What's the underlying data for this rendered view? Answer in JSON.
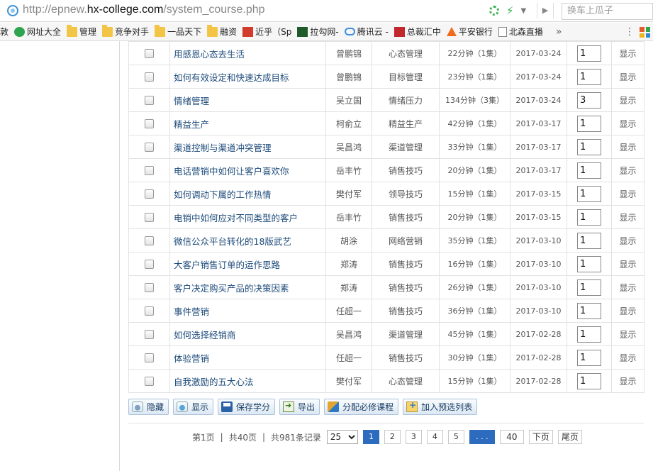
{
  "browser": {
    "url_prefix": "http://epnew.",
    "url_host": "hx-college.com",
    "url_path": "/system_course.php",
    "search_placeholder": "换车上瓜子"
  },
  "bookmarks": [
    {
      "label": "敦",
      "icon": "none"
    },
    {
      "label": "网址大全",
      "icon": "green"
    },
    {
      "label": "管理",
      "icon": "folder"
    },
    {
      "label": "竞争对手",
      "icon": "folder"
    },
    {
      "label": "一品天下",
      "icon": "folder"
    },
    {
      "label": "融资",
      "icon": "folder"
    },
    {
      "label": "近乎（Sp",
      "icon": "red"
    },
    {
      "label": "拉勾网-",
      "icon": "dark"
    },
    {
      "label": "腾讯云 -",
      "icon": "cloud"
    },
    {
      "label": "总裁汇中",
      "icon": "crown"
    },
    {
      "label": "平安银行",
      "icon": "tri"
    },
    {
      "label": "北森直播",
      "icon": "page"
    }
  ],
  "courses": [
    {
      "name": "用感恩心态去生活",
      "teacher": "曾鹏锦",
      "category": "心态管理",
      "duration": "22分钟（1集）",
      "date": "2017-03-24",
      "credit": "1",
      "action": "显示"
    },
    {
      "name": "如何有效设定和快速达成目标",
      "teacher": "曾鹏锦",
      "category": "目标管理",
      "duration": "23分钟（1集）",
      "date": "2017-03-24",
      "credit": "1",
      "action": "显示"
    },
    {
      "name": "情绪管理",
      "teacher": "吴立国",
      "category": "情绪压力",
      "duration": "134分钟（3集）",
      "date": "2017-03-24",
      "credit": "3",
      "action": "显示"
    },
    {
      "name": "精益生产",
      "teacher": "柯俞立",
      "category": "精益生产",
      "duration": "42分钟（1集）",
      "date": "2017-03-17",
      "credit": "1",
      "action": "显示"
    },
    {
      "name": "渠道控制与渠道冲突管理",
      "teacher": "吴昌鸿",
      "category": "渠道管理",
      "duration": "33分钟（1集）",
      "date": "2017-03-17",
      "credit": "1",
      "action": "显示"
    },
    {
      "name": "电话营销中如何让客户喜欢你",
      "teacher": "岳丰竹",
      "category": "销售技巧",
      "duration": "20分钟（1集）",
      "date": "2017-03-17",
      "credit": "1",
      "action": "显示"
    },
    {
      "name": "如何调动下属的工作热情",
      "teacher": "樊付军",
      "category": "领导技巧",
      "duration": "15分钟（1集）",
      "date": "2017-03-15",
      "credit": "1",
      "action": "显示"
    },
    {
      "name": "电销中如何应对不同类型的客户",
      "teacher": "岳丰竹",
      "category": "销售技巧",
      "duration": "20分钟（1集）",
      "date": "2017-03-15",
      "credit": "1",
      "action": "显示"
    },
    {
      "name": "微信公众平台转化的18版武艺",
      "teacher": "胡涂",
      "category": "网络营销",
      "duration": "35分钟（1集）",
      "date": "2017-03-10",
      "credit": "1",
      "action": "显示"
    },
    {
      "name": "大客户销售订单的运作思路",
      "teacher": "郑涛",
      "category": "销售技巧",
      "duration": "16分钟（1集）",
      "date": "2017-03-10",
      "credit": "1",
      "action": "显示"
    },
    {
      "name": "客户决定购买产品的决策因素",
      "teacher": "郑涛",
      "category": "销售技巧",
      "duration": "26分钟（1集）",
      "date": "2017-03-10",
      "credit": "1",
      "action": "显示"
    },
    {
      "name": "事件营销",
      "teacher": "任超一",
      "category": "销售技巧",
      "duration": "36分钟（1集）",
      "date": "2017-03-10",
      "credit": "1",
      "action": "显示"
    },
    {
      "name": "如何选择经销商",
      "teacher": "吴昌鸿",
      "category": "渠道管理",
      "duration": "45分钟（1集）",
      "date": "2017-02-28",
      "credit": "1",
      "action": "显示"
    },
    {
      "name": "体验营销",
      "teacher": "任超一",
      "category": "销售技巧",
      "duration": "30分钟（1集）",
      "date": "2017-02-28",
      "credit": "1",
      "action": "显示"
    },
    {
      "name": "自我激励的五大心法",
      "teacher": "樊付军",
      "category": "心态管理",
      "duration": "15分钟（1集）",
      "date": "2017-02-28",
      "credit": "1",
      "action": "显示"
    }
  ],
  "actions": {
    "hide": "隐藏",
    "show": "显示",
    "save_credit": "保存学分",
    "export": "导出",
    "assign_required": "分配必修课程",
    "add_preselect": "加入预选列表"
  },
  "pagination": {
    "current_page_text": "第1页",
    "total_pages_text": "共40页",
    "total_records_text": "共981条记录",
    "page_size": "25",
    "pages": [
      "1",
      "2",
      "3",
      "4",
      "5"
    ],
    "ellipsis": ". . .",
    "last_page": "40",
    "next": "下页",
    "end": "尾页"
  },
  "colors": {
    "link": "#1c4a7a",
    "accent": "#2d6bbf"
  }
}
